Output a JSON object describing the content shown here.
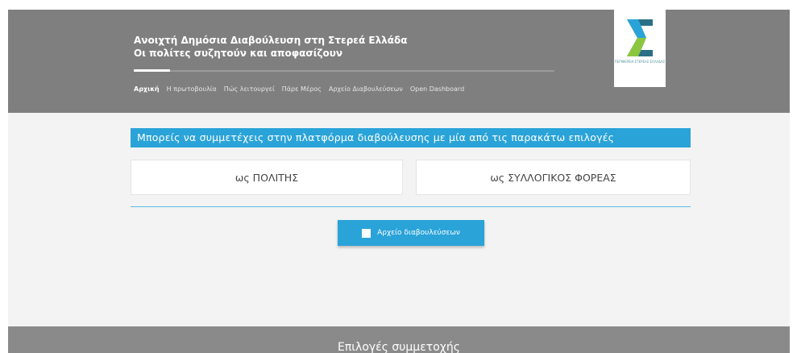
{
  "header": {
    "title_line1": "Ανοιχτή Δημόσια Διαβούλευση στη Στερεά Ελλάδα",
    "title_line2": "Οι πολίτες συζητούν και αποφασίζουν",
    "logo_text": "ΠΕΡΙΦΕΡΕΙΑ ΣΤΕΡΕΑΣ ΕΛΛΑΔΑΣ",
    "accent": "#2aa3d8"
  },
  "nav": {
    "items": [
      "Αρχική",
      "Η πρωτοβουλία",
      "Πώς λειτουργεί",
      "Πάρε Μέρος",
      "Αρχείο Διαβουλεύσεων",
      "Open Dashboard"
    ],
    "active_index": 0
  },
  "main": {
    "banner": "Μπορείς να συμμετέχεις στην πλατφόρμα διαβούλευσης με μία από τις παρακάτω επιλογές",
    "option_citizen": "ως ΠΟΛΙΤΗΣ",
    "option_org": "ως ΣΥΛΛΟΓΙΚΟΣ ΦΟΡΕΑΣ",
    "archive_button": "Αρχείο διαβουλεύσεων",
    "archive_icon": "square-icon"
  },
  "footer": {
    "title": "Επιλογές συμμετοχής"
  }
}
